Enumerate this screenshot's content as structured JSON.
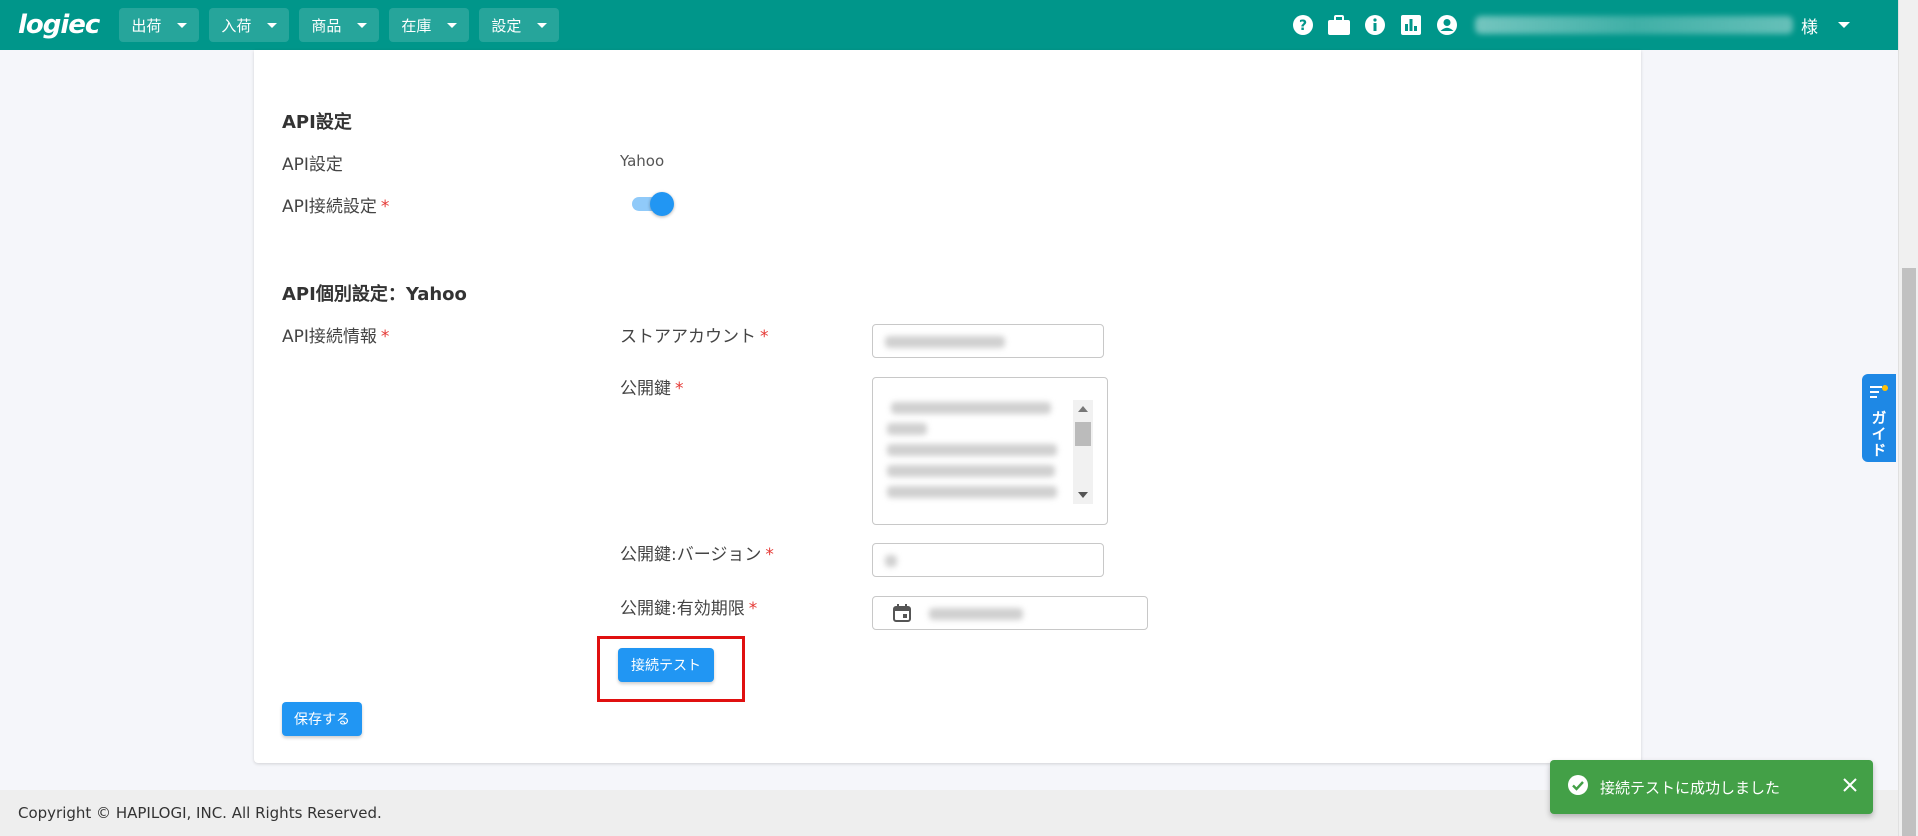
{
  "header": {
    "logo": "logiec",
    "nav": [
      {
        "label": "出荷"
      },
      {
        "label": "入荷"
      },
      {
        "label": "商品"
      },
      {
        "label": "在庫"
      },
      {
        "label": "設定"
      }
    ],
    "icons": [
      "help-icon",
      "briefcase-icon",
      "info-icon",
      "report-icon",
      "account-icon"
    ],
    "user_suffix": "様",
    "accent_color": "#00968a"
  },
  "api_settings": {
    "section_title": "API設定",
    "api_label": "API設定",
    "api_value": "Yahoo",
    "connection_label": "API接続設定",
    "connection_enabled": true,
    "required_mark": "*"
  },
  "api_individual": {
    "section_title": "API個別設定：Yahoo",
    "info_label": "API接続情報",
    "store_account_label": "ストアアカウント",
    "public_key_label": "公開鍵",
    "public_key_version_label": "公開鍵:バージョン",
    "public_key_expiry_label": "公開鍵:有効期限",
    "test_button": "接続テスト"
  },
  "actions": {
    "save_button": "保存する"
  },
  "guide": {
    "label": "ガイド"
  },
  "footer": {
    "copyright": "Copyright © HAPILOGI, INC. All Rights Reserved."
  },
  "snackbar": {
    "message": "接続テストに成功しました",
    "color": "#43a047"
  },
  "primary_color": "#2196f3"
}
